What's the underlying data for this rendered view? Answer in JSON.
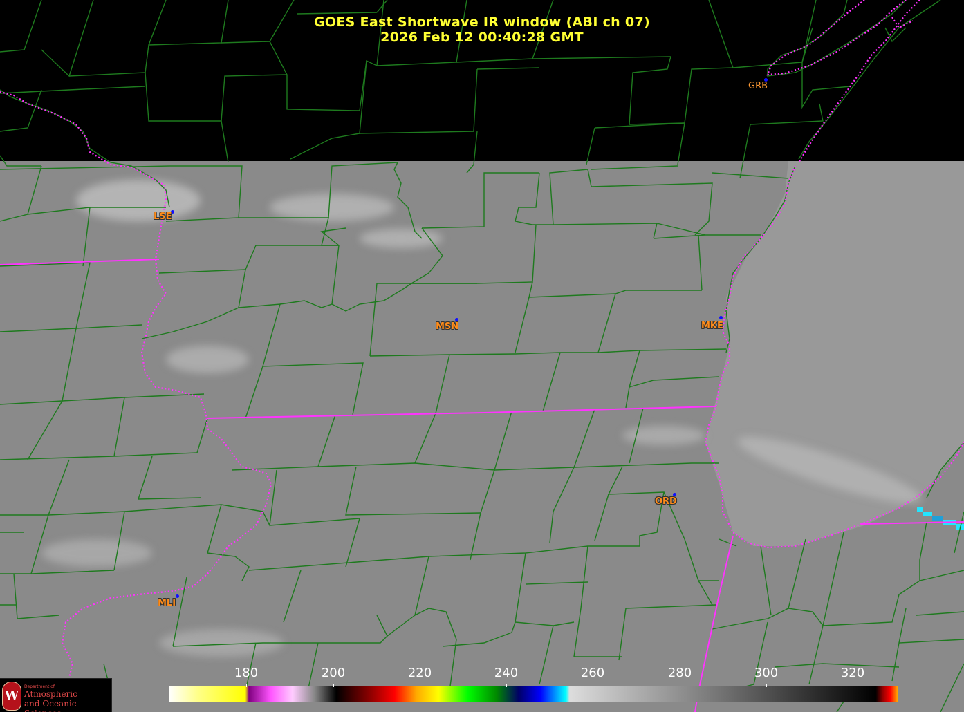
{
  "title": {
    "line1": "GOES East Shortwave IR window (ABI ch 07)",
    "line2": "2026 Feb 12  00:40:28 GMT"
  },
  "stations": [
    "LSE",
    "MSN",
    "MKE",
    "GRB",
    "ORD",
    "MLI"
  ],
  "colorbar": {
    "ticks": [
      "180",
      "200",
      "220",
      "240",
      "260",
      "280",
      "300",
      "320"
    ]
  },
  "logo": {
    "seal": "W",
    "small_text": "Department of",
    "line1": "Atmospheric",
    "line2": "and Oceanic Sciences"
  },
  "colors": {
    "title": "#ffff33",
    "county_lines": "#1e7a1e",
    "state_borders": "#ff33ff",
    "station_labels": "#ff8c1a",
    "station_dots": "#1010ff"
  }
}
